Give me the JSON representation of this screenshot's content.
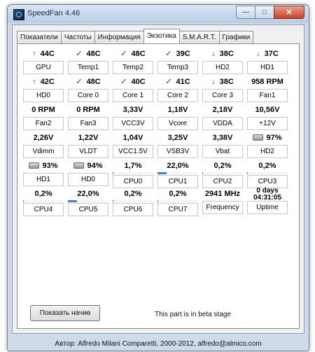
{
  "window": {
    "title": "SpeedFan 4.46"
  },
  "controls": {
    "minimize": "—",
    "maximize": "□",
    "close": "✕"
  },
  "tabs": [
    {
      "label": "Показатели"
    },
    {
      "label": "Частоты"
    },
    {
      "label": "Информация"
    },
    {
      "label": "Экзотика",
      "active": true
    },
    {
      "label": "S.M.A.R.T."
    },
    {
      "label": "Графики"
    }
  ],
  "readings": [
    {
      "value": "44C",
      "label": "GPU",
      "icon": "arrow-up-icon"
    },
    {
      "value": "48C",
      "label": "Temp1",
      "icon": "check-icon"
    },
    {
      "value": "48C",
      "label": "Temp2",
      "icon": "check-icon"
    },
    {
      "value": "39C",
      "label": "Temp3",
      "icon": "check-icon"
    },
    {
      "value": "38C",
      "label": "HD2",
      "icon": "arrow-down-icon"
    },
    {
      "value": "37C",
      "label": "HD1",
      "icon": "arrow-down-icon"
    },
    {
      "value": "42C",
      "label": "HD0",
      "icon": "arrow-up-icon"
    },
    {
      "value": "48C",
      "label": "Core 0",
      "icon": "check-icon"
    },
    {
      "value": "40C",
      "label": "Core 1",
      "icon": "check-icon"
    },
    {
      "value": "41C",
      "label": "Core 2",
      "icon": "check-icon"
    },
    {
      "value": "38C",
      "label": "Core 3",
      "icon": "arrow-down-icon"
    },
    {
      "value": "958 RPM",
      "label": "Fan1"
    },
    {
      "value": "0 RPM",
      "label": "Fan2"
    },
    {
      "value": "0 RPM",
      "label": "Fan3"
    },
    {
      "value": "3,33V",
      "label": "VCC3V"
    },
    {
      "value": "1,18V",
      "label": "Vcore"
    },
    {
      "value": "2,18V",
      "label": "VDDA"
    },
    {
      "value": "10,56V",
      "label": "+12V"
    },
    {
      "value": "2,26V",
      "label": "Vdimm"
    },
    {
      "value": "1,22V",
      "label": "VLDT"
    },
    {
      "value": "1,04V",
      "label": "VCC1.5V"
    },
    {
      "value": "3,25V",
      "label": "VSB3V"
    },
    {
      "value": "3,38V",
      "label": "Vbat"
    },
    {
      "value": "97%",
      "label": "HD2",
      "icon": "hdd-icon"
    },
    {
      "value": "93%",
      "label": "HD1",
      "icon": "hdd-icon"
    },
    {
      "value": "94%",
      "label": "HD0",
      "icon": "hdd-icon"
    },
    {
      "value": "1,7%",
      "label": "CPU0",
      "bar": 0.017
    },
    {
      "value": "22,0%",
      "label": "CPU1",
      "bar": 0.22
    },
    {
      "value": "0,2%",
      "label": "CPU2",
      "bar": 0.002
    },
    {
      "value": "0,2%",
      "label": "CPU3",
      "bar": 0.002
    },
    {
      "value": "0,2%",
      "label": "CPU4",
      "bar": 0.002
    },
    {
      "value": "22,0%",
      "label": "CPU5",
      "bar": 0.22
    },
    {
      "value": "0,2%",
      "label": "CPU6",
      "bar": 0.002
    },
    {
      "value": "0,2%",
      "label": "CPU7",
      "bar": 0.002
    },
    {
      "value": "2941 MHz",
      "label": "Frequency"
    },
    {
      "value": "0 days\n04:31:05",
      "label": "Uptime"
    }
  ],
  "footer": {
    "show_button": "Показать начиѳ",
    "beta_note": "This part is in beta stage",
    "status": "Автор: Alfredo Milani Comparetti, 2000-2012, alfredo@almico.com"
  },
  "colors": {
    "accent": "#4a7fd0",
    "hot": "#d51a1a",
    "cool": "#2048b8",
    "ok": "#3b9a3b"
  }
}
